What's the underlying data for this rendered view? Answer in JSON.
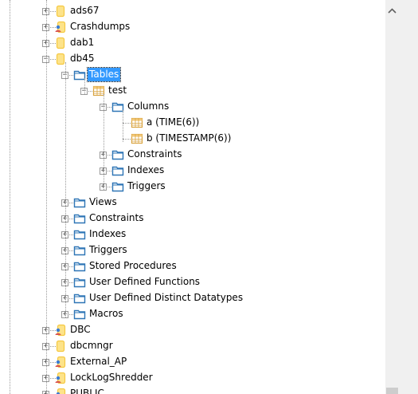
{
  "tree": [
    {
      "id": "ads67",
      "label": "ads67",
      "level": 0,
      "icon": "db-icon",
      "expand": "+"
    },
    {
      "id": "crashdumps",
      "label": "Crashdumps",
      "level": 0,
      "icon": "user-db-icon",
      "expand": "+"
    },
    {
      "id": "dab1",
      "label": "dab1",
      "level": 0,
      "icon": "db-icon",
      "expand": "+"
    },
    {
      "id": "db45",
      "label": "db45",
      "level": 0,
      "icon": "db-icon",
      "expand": "-"
    },
    {
      "id": "tables",
      "label": "Tables",
      "level": 1,
      "icon": "folder-icon",
      "expand": "-",
      "selected": true
    },
    {
      "id": "test",
      "label": "test",
      "level": 2,
      "icon": "table-icon",
      "expand": "-"
    },
    {
      "id": "columns",
      "label": "Columns",
      "level": 3,
      "icon": "folder-icon",
      "expand": "-"
    },
    {
      "id": "col-a",
      "label": "a (TIME(6))",
      "level": 4,
      "icon": "table-icon",
      "expand": ""
    },
    {
      "id": "col-b",
      "label": "b (TIMESTAMP(6))",
      "level": 4,
      "icon": "table-icon",
      "expand": ""
    },
    {
      "id": "constraints-t",
      "label": "Constraints",
      "level": 3,
      "icon": "folder-icon",
      "expand": "+"
    },
    {
      "id": "indexes-t",
      "label": "Indexes",
      "level": 3,
      "icon": "folder-icon",
      "expand": "+"
    },
    {
      "id": "triggers-t",
      "label": "Triggers",
      "level": 3,
      "icon": "folder-icon",
      "expand": "+"
    },
    {
      "id": "views",
      "label": "Views",
      "level": 1,
      "icon": "folder-icon",
      "expand": "+"
    },
    {
      "id": "constraints",
      "label": "Constraints",
      "level": 1,
      "icon": "folder-icon",
      "expand": "+"
    },
    {
      "id": "indexes",
      "label": "Indexes",
      "level": 1,
      "icon": "folder-icon",
      "expand": "+"
    },
    {
      "id": "triggers",
      "label": "Triggers",
      "level": 1,
      "icon": "folder-icon",
      "expand": "+"
    },
    {
      "id": "stored-procedures",
      "label": "Stored Procedures",
      "level": 1,
      "icon": "folder-icon",
      "expand": "+"
    },
    {
      "id": "udf",
      "label": "User Defined Functions",
      "level": 1,
      "icon": "folder-icon",
      "expand": "+"
    },
    {
      "id": "udt",
      "label": "User Defined Distinct Datatypes",
      "level": 1,
      "icon": "folder-icon",
      "expand": "+"
    },
    {
      "id": "macros",
      "label": "Macros",
      "level": 1,
      "icon": "folder-icon",
      "expand": "+"
    },
    {
      "id": "dbc",
      "label": "DBC",
      "level": 0,
      "icon": "user-db-icon",
      "expand": "+"
    },
    {
      "id": "dbcmngr",
      "label": "dbcmngr",
      "level": 0,
      "icon": "db-icon",
      "expand": "+"
    },
    {
      "id": "external-ap",
      "label": "External_AP",
      "level": 0,
      "icon": "user-db-icon",
      "expand": "+"
    },
    {
      "id": "locklogshredder",
      "label": "LockLogShredder",
      "level": 0,
      "icon": "user-db-icon",
      "expand": "+"
    },
    {
      "id": "public",
      "label": "PUBLIC",
      "level": 0,
      "icon": "user-db-icon",
      "expand": "+"
    }
  ],
  "scrollbar": {
    "up_arrow_icon": "chevron-up-icon"
  },
  "colors": {
    "selection": "#3399ff",
    "folder": "#2e75b6",
    "db": "#f5c842",
    "table": "#d9a441"
  }
}
